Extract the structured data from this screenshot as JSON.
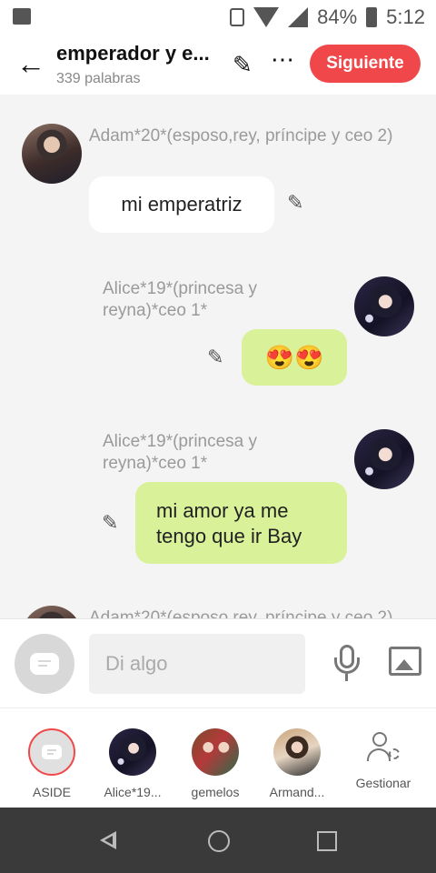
{
  "status_bar": {
    "battery": "84%",
    "time": "5:12"
  },
  "header": {
    "title": "emperador y e...",
    "subtitle": "339 palabras",
    "next_label": "Siguiente"
  },
  "messages": [
    {
      "sender": "Adam*20*(esposo,rey, príncipe y ceo 2)",
      "text": "mi emperatriz",
      "side": "left"
    },
    {
      "sender": "Alice*19*(princesa y reyna)*ceo 1*",
      "text": "😍😍",
      "side": "right"
    },
    {
      "sender": "Alice*19*(princesa y reyna)*ceo 1*",
      "text": "mi amor ya me tengo que ir Bay",
      "side": "right"
    },
    {
      "sender": "Adam*20*(esposo,rey, príncipe y ceo 2)",
      "text": "",
      "side": "left"
    }
  ],
  "composer": {
    "placeholder": "Di algo"
  },
  "characters": [
    {
      "label": "ASIDE",
      "selected": true
    },
    {
      "label": "Alice*19..."
    },
    {
      "label": "gemelos"
    },
    {
      "label": "Armand..."
    },
    {
      "label": "Gestionar"
    }
  ],
  "colors": {
    "accent": "#f0484a",
    "right_bubble": "#d9f29a",
    "left_bubble": "#ffffff"
  },
  "icons": [
    "back-arrow-icon",
    "pencil-icon",
    "more-icon",
    "microphone-icon",
    "image-icon",
    "manage-icon"
  ]
}
